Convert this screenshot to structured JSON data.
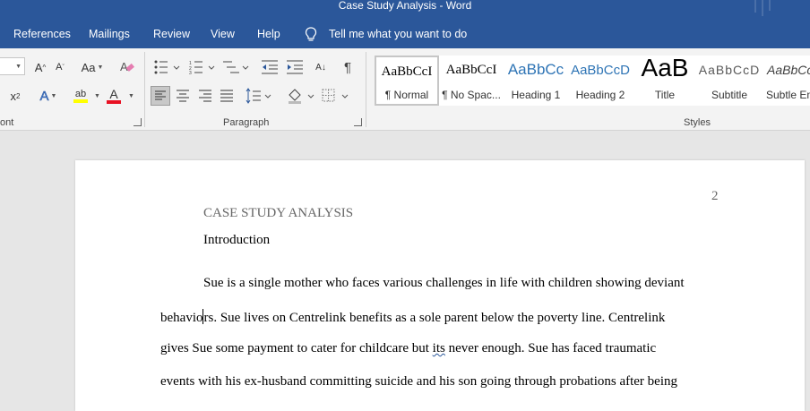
{
  "window": {
    "title": "Case Study Analysis  -  Word"
  },
  "menu": [
    "References",
    "Mailings",
    "Review",
    "View",
    "Help"
  ],
  "tell_me": "Tell me what you want to do",
  "ribbon": {
    "font_group": "ont",
    "paragraph_group": "Paragraph",
    "styles_group": "Styles",
    "font_case_label": "Aa",
    "grow_font_label": "A",
    "shrink_font_label": "A",
    "subscript_label": "x",
    "text_effects_label": "A",
    "font_color_label": "A",
    "highlight_label": "ab",
    "pilcrow": "¶",
    "sort_label": "A↓",
    "styles": [
      {
        "sample": "AaBbCcI",
        "name": "¶ Normal"
      },
      {
        "sample": "AaBbCcI",
        "name": "¶ No Spac..."
      },
      {
        "sample": "AaBbCc",
        "name": "Heading 1"
      },
      {
        "sample": "AaBbCcD",
        "name": "Heading 2"
      },
      {
        "sample": "AaB",
        "name": "Title"
      },
      {
        "sample": "AaBbCcD",
        "name": "Subtitle"
      },
      {
        "sample": "AaBbCcD",
        "name": "Subtle Em"
      }
    ]
  },
  "colors": {
    "title_bar": "#2b579a",
    "font_color_underline": "#e81123",
    "highlight_underline": "#ffff00"
  },
  "document": {
    "page_number": "2",
    "running_head": "CASE STUDY ANALYSIS",
    "heading": "Introduction",
    "lines": {
      "l1": "Sue is a single mother who faces various challenges in life with children showing deviant",
      "l2a": "behavio",
      "l2b": "rs. Sue lives on Centrelink benefits as a sole parent below the poverty line. Centrelink",
      "l3a": "gives Sue some payment to cater for childcare but ",
      "l3b": "its",
      "l3c": " never enough. Sue has faced traumatic",
      "l4": "events with his ex-husband committing suicide and his son going through probations after being"
    }
  }
}
